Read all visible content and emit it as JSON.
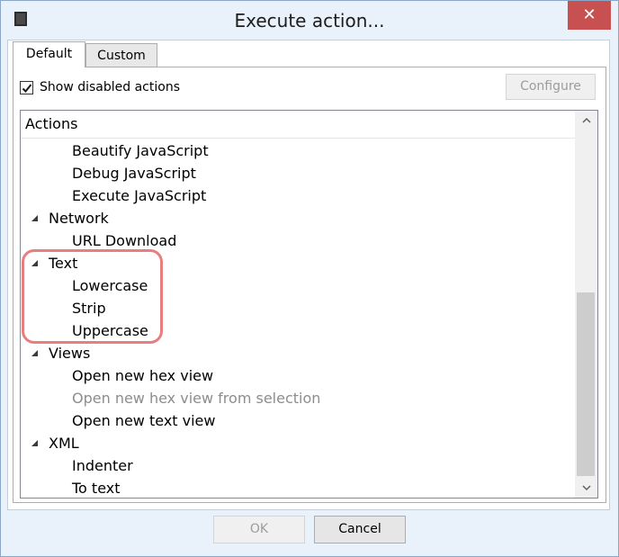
{
  "window": {
    "title": "Execute action..."
  },
  "tabs": [
    {
      "label": "Default",
      "active": true
    },
    {
      "label": "Custom",
      "active": false
    }
  ],
  "options": {
    "show_disabled_label": "Show disabled actions",
    "show_disabled_checked": true
  },
  "toolbar": {
    "configure_label": "Configure"
  },
  "tree": {
    "header": "Actions",
    "rows": [
      {
        "label": "Beautify JavaScript"
      },
      {
        "label": "Debug JavaScript"
      },
      {
        "label": "Execute JavaScript"
      },
      {
        "label": "Network"
      },
      {
        "label": "URL Download"
      },
      {
        "label": "Text"
      },
      {
        "label": "Lowercase"
      },
      {
        "label": "Strip"
      },
      {
        "label": "Uppercase"
      },
      {
        "label": "Views"
      },
      {
        "label": "Open new hex view"
      },
      {
        "label": "Open new hex view from selection",
        "disabled": true
      },
      {
        "label": "Open new text view"
      },
      {
        "label": "XML"
      },
      {
        "label": "Indenter"
      },
      {
        "label": "To text"
      }
    ]
  },
  "footer": {
    "ok_label": "OK",
    "cancel_label": "Cancel"
  },
  "colors": {
    "highlight": "#e87e7e",
    "close": "#c75050"
  }
}
